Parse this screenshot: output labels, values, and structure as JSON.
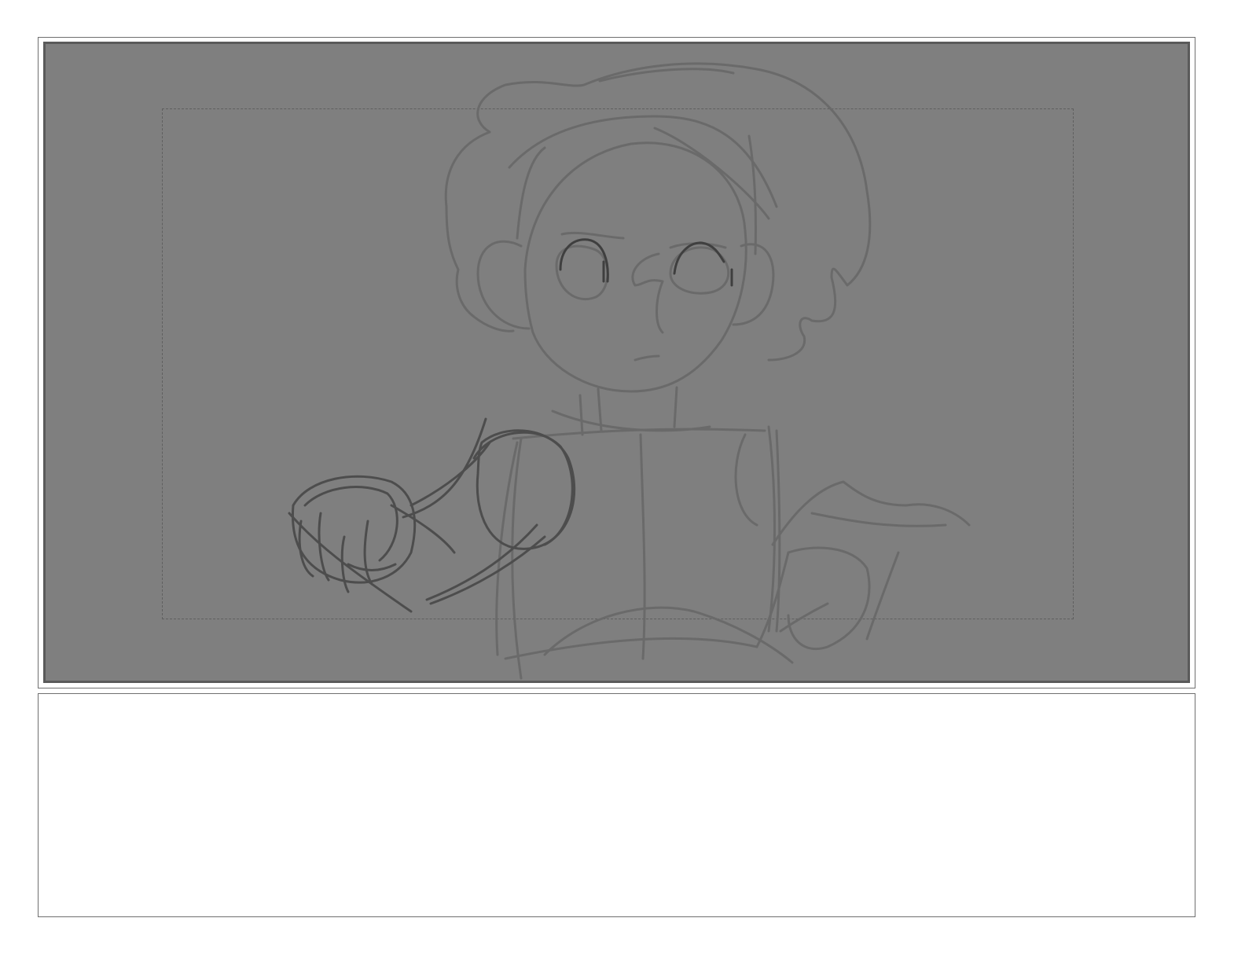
{
  "storyboard": {
    "panel": {
      "background_color": "#7f7f7f",
      "sketch_line_color": "#6a6a6a",
      "sketch_dark_line_color": "#4a4a4a",
      "frame_color": "#5a5a5a"
    },
    "notes": {
      "text": ""
    }
  }
}
